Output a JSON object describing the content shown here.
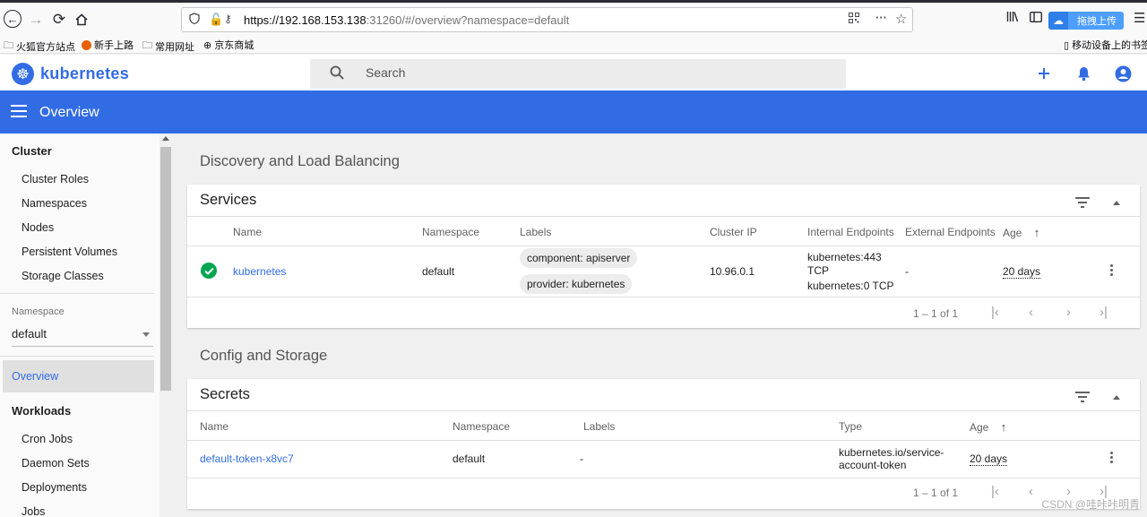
{
  "browser": {
    "url_host": "https://192.168.153.138",
    "url_rest": ":31260/#/overview?namespace=default",
    "upload_label": "拖拽上传",
    "bookmarks": [
      "火狐官方站点",
      "新手上路",
      "常用网址",
      "京东商城"
    ],
    "mobile_bookmarks": "移动设备上的书签"
  },
  "app": {
    "brand": "kubernetes",
    "search_placeholder": "Search",
    "page_title": "Overview"
  },
  "sidebar": {
    "cluster_heading": "Cluster",
    "cluster_items": [
      "Cluster Roles",
      "Namespaces",
      "Nodes",
      "Persistent Volumes",
      "Storage Classes"
    ],
    "namespace_label": "Namespace",
    "namespace_value": "default",
    "overview_label": "Overview",
    "workloads_heading": "Workloads",
    "workload_items": [
      "Cron Jobs",
      "Daemon Sets",
      "Deployments",
      "Jobs"
    ]
  },
  "sections": {
    "discovery": "Discovery and Load Balancing",
    "config": "Config and Storage"
  },
  "services": {
    "title": "Services",
    "headers": [
      "Name",
      "Namespace",
      "Labels",
      "Cluster IP",
      "Internal Endpoints",
      "External Endpoints",
      "Age"
    ],
    "row": {
      "name": "kubernetes",
      "namespace": "default",
      "labels": [
        "component: apiserver",
        "provider: kubernetes"
      ],
      "cluster_ip": "10.96.0.1",
      "internal_endpoints": [
        "kubernetes:443",
        "TCP",
        "kubernetes:0 TCP"
      ],
      "external_endpoints": "-",
      "age": "20 days"
    },
    "pagination": "1 – 1 of 1"
  },
  "secrets": {
    "title": "Secrets",
    "headers": [
      "Name",
      "Namespace",
      "Labels",
      "Type",
      "Age"
    ],
    "row": {
      "name": "default-token-x8vc7",
      "namespace": "default",
      "labels": "-",
      "type_line1": "kubernetes.io/service-",
      "type_line2": "account-token",
      "age": "20 days"
    },
    "pagination": "1 – 1 of 1"
  },
  "watermark": "CSDN @哇咔咔明青"
}
